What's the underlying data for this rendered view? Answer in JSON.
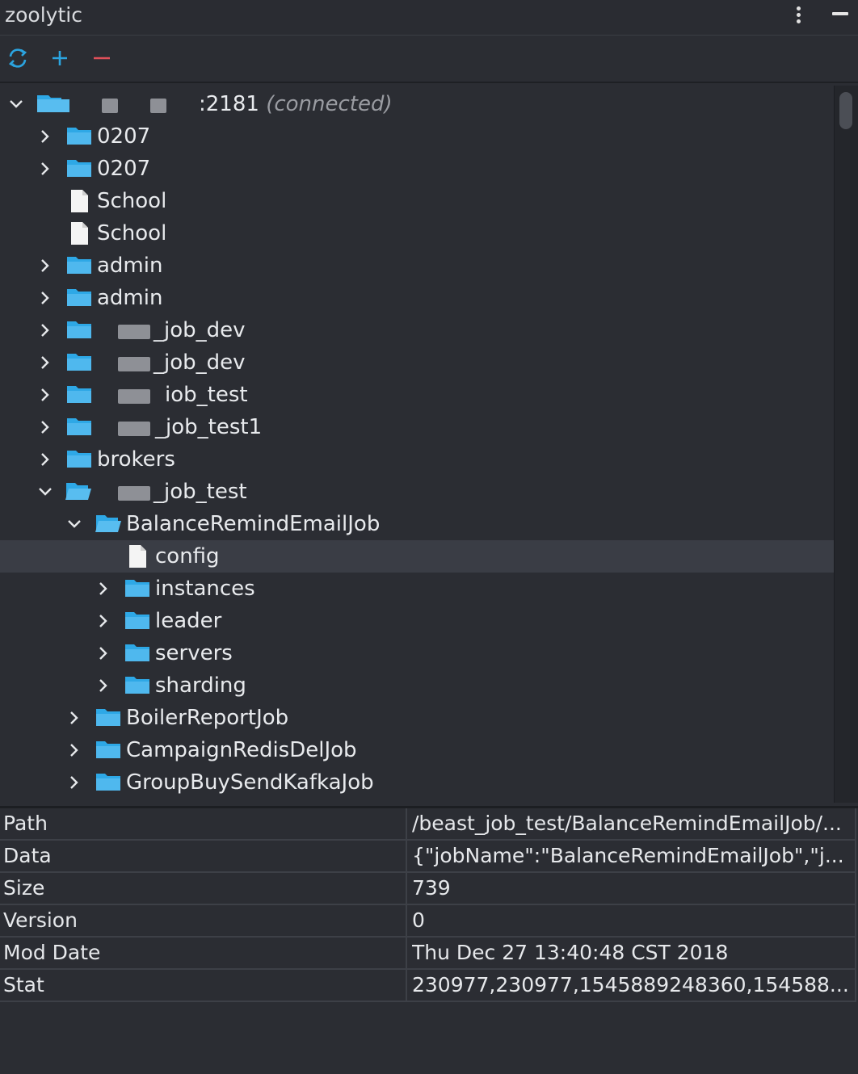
{
  "app": {
    "title": "zoolytic"
  },
  "colors": {
    "accent": "#2ba4e0",
    "folder": "#2ea8e6",
    "remove": "#e0505a",
    "refresh": "#2ba4e0"
  },
  "toolbar": {
    "icons": [
      "refresh-icon",
      "add-icon",
      "remove-icon"
    ]
  },
  "tree": {
    "root": {
      "label": ":2181",
      "status": "(connected)"
    },
    "nodes": [
      {
        "label": "0207",
        "type": "folder"
      },
      {
        "label": "0207",
        "type": "folder"
      },
      {
        "label": "School",
        "type": "file"
      },
      {
        "label": "School",
        "type": "file"
      },
      {
        "label": "admin",
        "type": "folder"
      },
      {
        "label": "admin",
        "type": "folder"
      },
      {
        "label": "_job_dev",
        "type": "folder"
      },
      {
        "label": "_job_dev",
        "type": "folder"
      },
      {
        "label": "iob_test",
        "type": "folder"
      },
      {
        "label": "_job_test1",
        "type": "folder"
      },
      {
        "label": "brokers",
        "type": "folder"
      },
      {
        "label": "_job_test",
        "type": "folder"
      },
      {
        "label": "BalanceRemindEmailJob",
        "type": "folder"
      },
      {
        "label": "config",
        "type": "file"
      },
      {
        "label": "instances",
        "type": "folder"
      },
      {
        "label": "leader",
        "type": "folder"
      },
      {
        "label": "servers",
        "type": "folder"
      },
      {
        "label": "sharding",
        "type": "folder"
      },
      {
        "label": "BoilerReportJob",
        "type": "folder"
      },
      {
        "label": "CampaignRedisDelJob",
        "type": "folder"
      },
      {
        "label": "GroupBuySendKafkaJob",
        "type": "folder"
      }
    ]
  },
  "properties": [
    {
      "key": "Path",
      "value": "/beast_job_test/BalanceRemindEmailJob/..."
    },
    {
      "key": "Data",
      "value": "{\"jobName\":\"BalanceRemindEmailJob\",\"j..."
    },
    {
      "key": "Size",
      "value": "739"
    },
    {
      "key": "Version",
      "value": "0"
    },
    {
      "key": "Mod Date",
      "value": "Thu Dec 27 13:40:48 CST 2018"
    },
    {
      "key": "Stat",
      "value": "230977,230977,1545889248360,154588..."
    }
  ]
}
